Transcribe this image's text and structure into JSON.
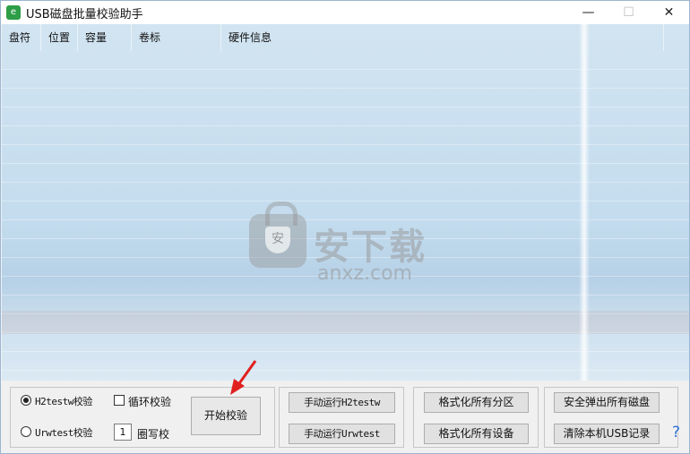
{
  "window": {
    "title": "USB磁盘批量校验助手",
    "icon": "app-icon",
    "minimize": "—",
    "maximize": "☐",
    "close": "✕"
  },
  "list": {
    "columns": [
      "盘符",
      "位置",
      "容量",
      "卷标",
      "硬件信息"
    ]
  },
  "watermark": {
    "cn": "安下载",
    "en": "anxz.com",
    "shield": "安"
  },
  "options": {
    "mode1_label": "H2testw校验",
    "mode2_label": "Urwtest校验",
    "mode_selected": "H2testw校验",
    "loop_label": "循环校验",
    "loop_checked": false,
    "rounds_value": "1",
    "rounds_label": "圈写校",
    "start_label": "开始校验"
  },
  "manual": {
    "run_h2": "手动运行H2testw",
    "run_urw": "手动运行Urwtest"
  },
  "format": {
    "partitions": "格式化所有分区",
    "devices": "格式化所有设备"
  },
  "device": {
    "eject": "安全弹出所有磁盘",
    "clear_usb": "清除本机USB记录"
  },
  "help": "?",
  "colors": {
    "accent": "#2a6fd3",
    "arrow": "#e02020"
  }
}
